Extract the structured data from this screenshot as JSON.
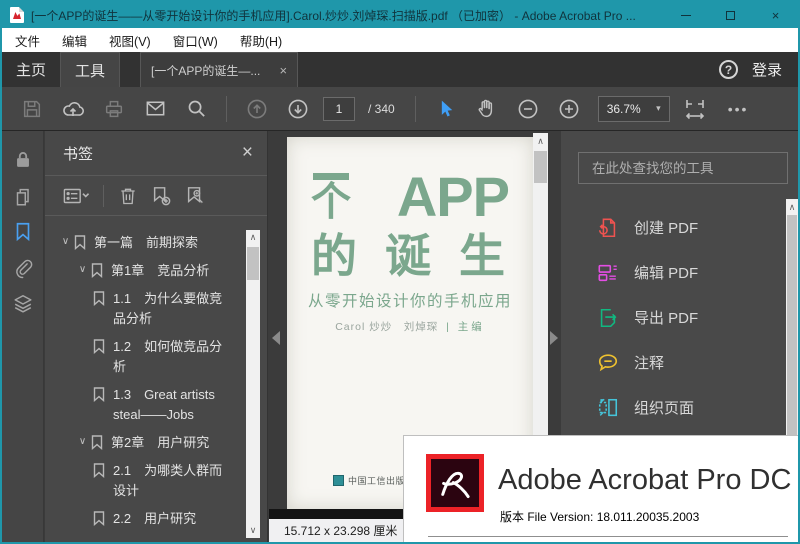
{
  "window": {
    "title": "[一个APP的诞生——从零开始设计你的手机应用].Carol.炒炒.刘焯琛.扫描版.pdf （已加密） - Adobe Acrobat Pro ..."
  },
  "menu": {
    "items": [
      "文件",
      "编辑",
      "视图(V)",
      "窗口(W)",
      "帮助(H)"
    ]
  },
  "tabbar": {
    "home": "主页",
    "tools": "工具",
    "document_tab": "[一个APP的诞生—...",
    "sign_in": "登录"
  },
  "toolbar": {
    "page_current": "1",
    "page_total": "/ 340",
    "zoom_level": "36.7%"
  },
  "bookmarks": {
    "title": "书签",
    "items": [
      {
        "label": "第一篇　前期探索"
      },
      {
        "label": "第1章　竞品分析"
      },
      {
        "label": "1.1　为什么要做竞品分析"
      },
      {
        "label": "1.2　如何做竞品分析"
      },
      {
        "label": "1.3　Great artists steal——Jobs"
      },
      {
        "label": "第2章　用户研究"
      },
      {
        "label": "2.1　为哪类人群而设计"
      },
      {
        "label": "2.2　用户研究"
      }
    ]
  },
  "document": {
    "cover": {
      "title_ge": "个",
      "title_app": "APP",
      "title_line2": "的诞生",
      "subtitle": "从零开始设计你的手机应用",
      "authors": "Carol 炒炒　刘焯琛",
      "editor_divider": "|",
      "editor": "主编",
      "publisher": "中国工信出版集团"
    },
    "page_size": "15.712 x 23.298 厘米"
  },
  "tools_panel": {
    "search_placeholder": "在此处查找您的工具",
    "tools": [
      {
        "label": "创建 PDF",
        "color": "#ef5350"
      },
      {
        "label": "编辑 PDF",
        "color": "#e44ee4"
      },
      {
        "label": "导出 PDF",
        "color": "#10b981"
      },
      {
        "label": "注释",
        "color": "#eec12f"
      },
      {
        "label": "组织页面",
        "color": "#45c4d9"
      }
    ]
  },
  "splash": {
    "title": "Adobe Acrobat Pro DC",
    "version": "版本 File Version: 18.011.20035.2003"
  },
  "icons": {
    "close": "×",
    "help": "?",
    "more": "•••",
    "caret_down": "▾",
    "chevron_expanded": "∨",
    "scroll_up": "∧",
    "scroll_down": "∨"
  },
  "colors": {
    "titlebar": "#1f97aa",
    "accent_blue": "#3f9ef5",
    "cover_green": "#7ba78d",
    "splash_red": "#ec2227"
  }
}
